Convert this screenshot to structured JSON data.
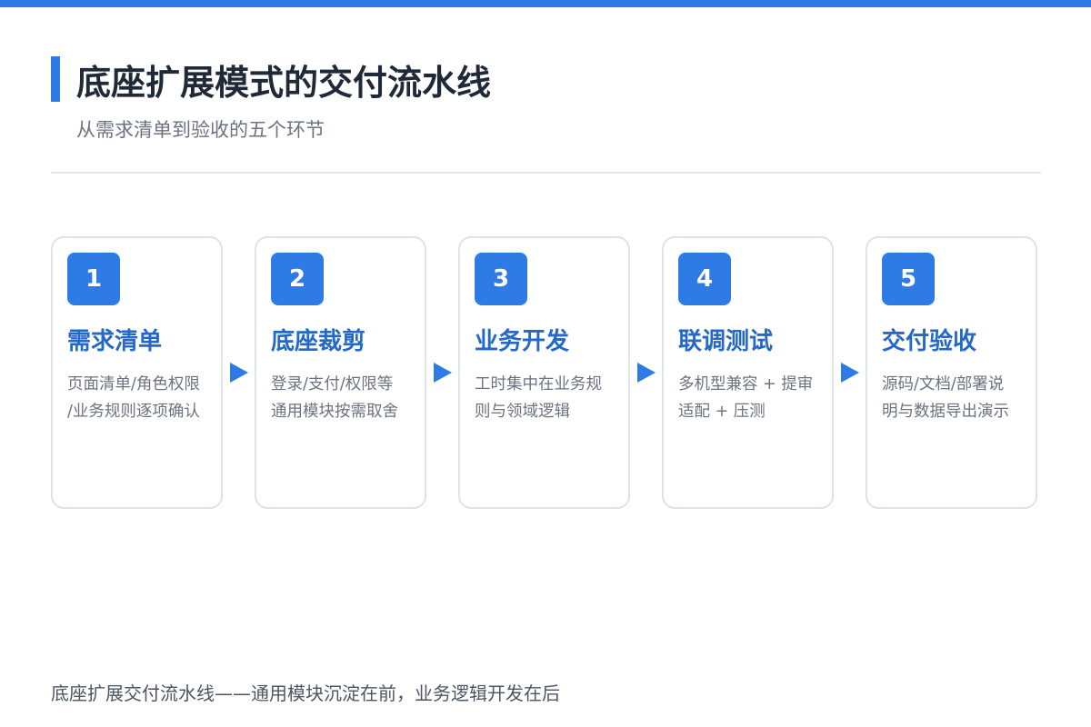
{
  "slide": {
    "title": "底座扩展模式的交付流水线",
    "subtitle": "从需求清单到验收的五个环节",
    "footer": "底座扩展交付流水线——通用模块沉淀在前，业务逻辑开发在后",
    "accent_color": "#2f7be5",
    "step_title_color": "#2468c8"
  },
  "steps": [
    {
      "number": "1",
      "title": "需求清单",
      "desc_lines": [
        "页面清单/角色权限",
        "/业务规则逐项确认"
      ]
    },
    {
      "number": "2",
      "title": "底座裁剪",
      "desc_lines": [
        "登录/支付/权限等",
        "通用模块按需取舍"
      ]
    },
    {
      "number": "3",
      "title": "业务开发",
      "desc_lines": [
        "工时集中在业务规",
        "则与领域逻辑"
      ]
    },
    {
      "number": "4",
      "title": "联调测试",
      "desc_lines": [
        "多机型兼容 + 提审",
        "适配 + 压测"
      ]
    },
    {
      "number": "5",
      "title": "交付验收",
      "desc_lines": [
        "源码/文档/部署说",
        "明与数据导出演示"
      ]
    }
  ],
  "icons": {
    "step_connector": "arrow-right-icon"
  }
}
